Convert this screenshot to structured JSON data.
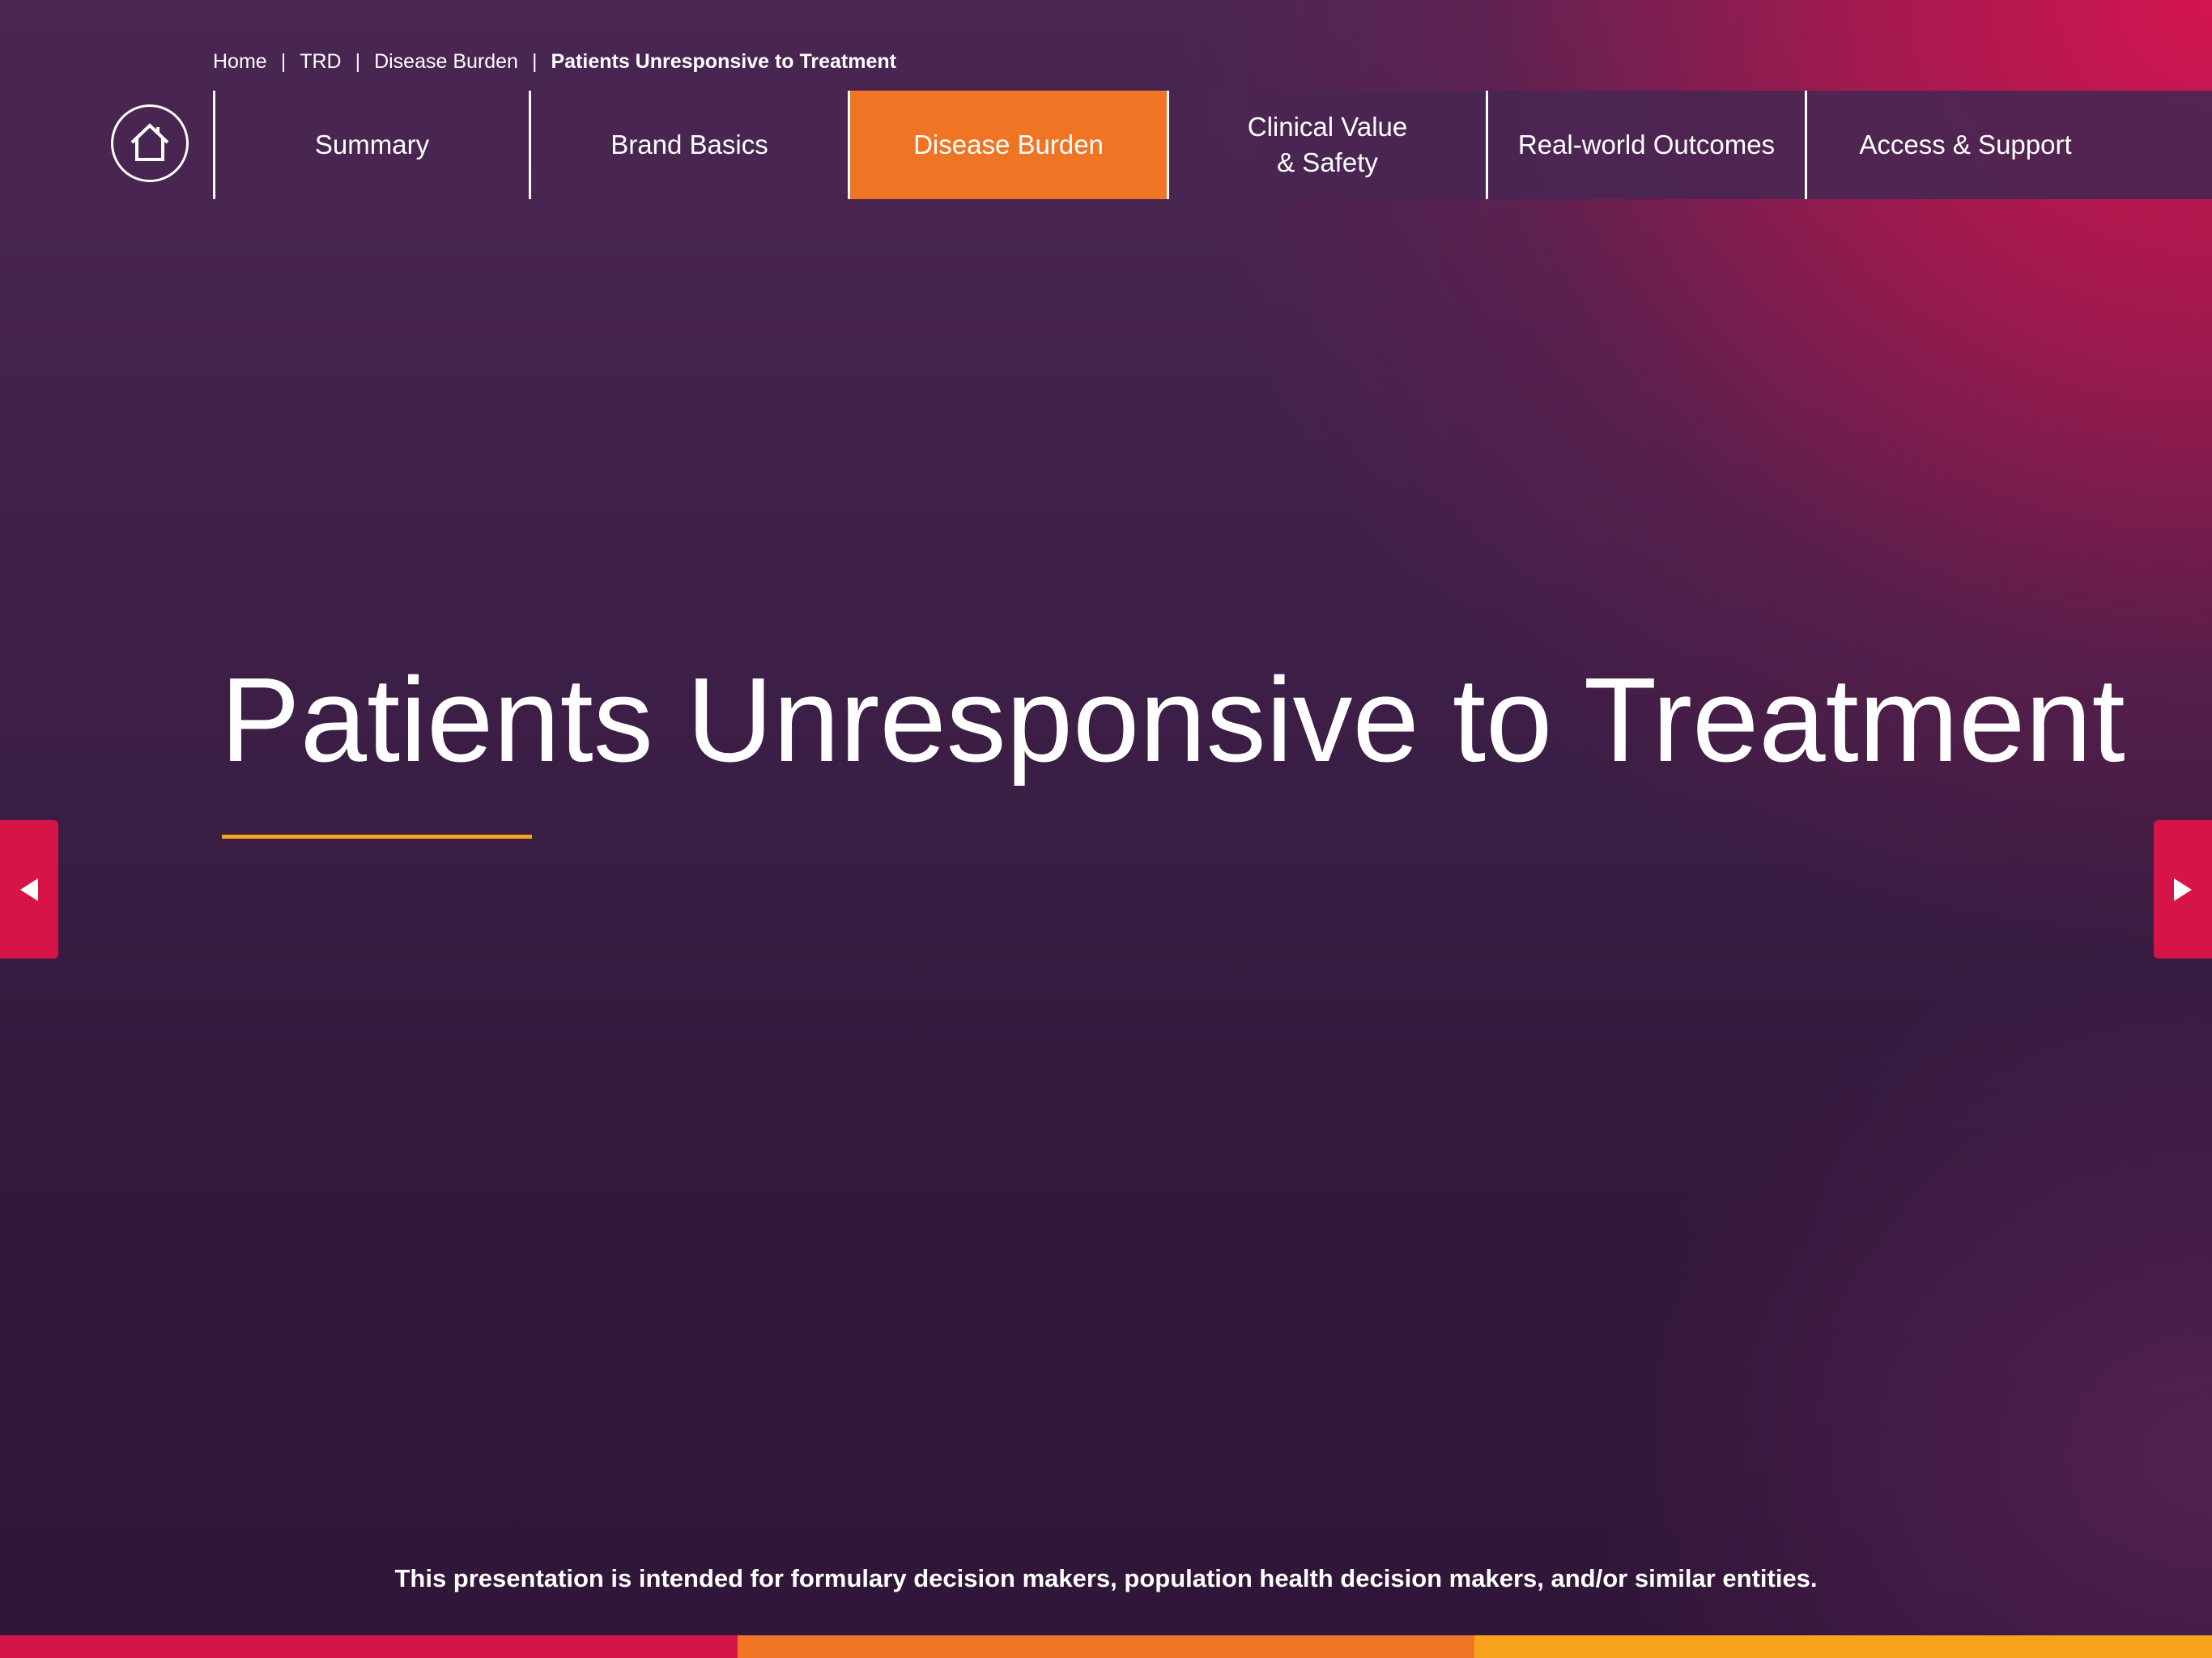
{
  "breadcrumb": {
    "items": [
      "Home",
      "TRD",
      "Disease Burden"
    ],
    "separator": "|",
    "current": "Patients Unresponsive to Treatment"
  },
  "nav": {
    "home_icon": "home-icon",
    "items": [
      {
        "label": "Summary"
      },
      {
        "label": "Brand Basics"
      },
      {
        "label": "Disease Burden",
        "active": true
      },
      {
        "line1": "Clinical Value",
        "line2": "& Safety"
      },
      {
        "label": "Real-world Outcomes"
      },
      {
        "label": "Access & Support"
      }
    ]
  },
  "page": {
    "title": "Patients Unresponsive to Treatment"
  },
  "arrows": {
    "prev_icon": "caret-left-icon",
    "next_icon": "caret-right-icon"
  },
  "footer": {
    "disclaimer": "This presentation is intended for formulary decision makers, population health decision makers, and/or similar entities."
  },
  "colors": {
    "active_tab": "#ef7423",
    "accent_underline": "#f5a21c",
    "arrow_button": "#d71447",
    "bottom_bar": [
      "#d71447",
      "#ef7423",
      "#f7a21b"
    ]
  }
}
